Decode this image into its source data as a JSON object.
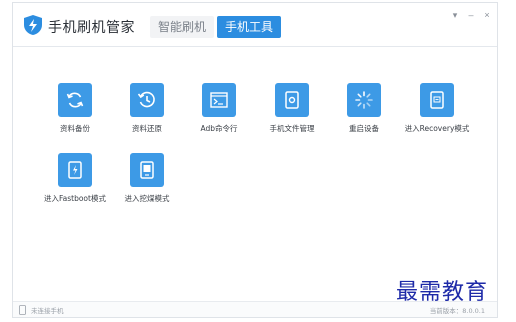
{
  "app": {
    "title": "手机刷机管家",
    "tabs": [
      {
        "label": "智能刷机",
        "active": false
      },
      {
        "label": "手机工具",
        "active": true
      }
    ],
    "window_controls": [
      "▾",
      "–",
      "×"
    ]
  },
  "tools": [
    {
      "label": "资料备份",
      "icon": "sync-icon"
    },
    {
      "label": "资料还原",
      "icon": "restore-clock-icon"
    },
    {
      "label": "Adb命令行",
      "icon": "terminal-icon"
    },
    {
      "label": "手机文件管理",
      "icon": "phone-file-icon"
    },
    {
      "label": "重启设备",
      "icon": "loading-spinner-icon"
    },
    {
      "label": "进入Recovery模式",
      "icon": "recovery-phone-icon"
    },
    {
      "label": "进入Fastboot模式",
      "icon": "fastboot-phone-icon"
    },
    {
      "label": "进入挖煤模式",
      "icon": "download-mode-phone-icon"
    }
  ],
  "status": {
    "connection": "未连接手机",
    "version": "当前版本：8.0.0.1"
  },
  "watermark": "最需教育",
  "colors": {
    "accent": "#3d9ae6",
    "tab_active": "#2c8de0",
    "watermark": "#1e2aa8"
  }
}
